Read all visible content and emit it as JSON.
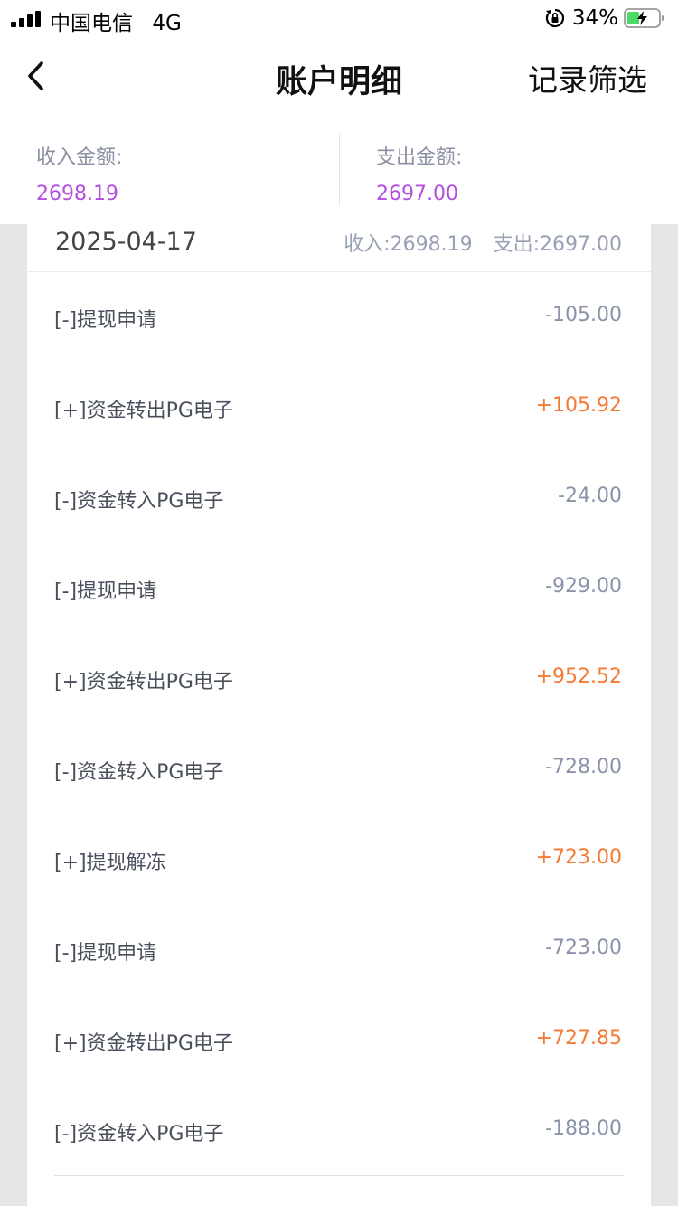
{
  "status_bar": {
    "carrier": "中国电信",
    "network": "4G",
    "battery": "34%"
  },
  "nav": {
    "back_icon": "chevron-left-icon",
    "title": "账户明细",
    "filter_label": "记录筛选"
  },
  "summary": {
    "income_label": "收入金额:",
    "income_value": "2698.19",
    "expense_label": "支出金额:",
    "expense_value": "2697.00"
  },
  "day": {
    "date": "2025-04-17",
    "income_total": "收入:2698.19",
    "expense_total": "支出:2697.00"
  },
  "transactions": [
    {
      "label": "[-]提现申请",
      "amount": "-105.00",
      "type": "neg"
    },
    {
      "label": "[+]资金转出PG电子",
      "amount": "+105.92",
      "type": "pos"
    },
    {
      "label": "[-]资金转入PG电子",
      "amount": "-24.00",
      "type": "neg"
    },
    {
      "label": "[-]提现申请",
      "amount": "-929.00",
      "type": "neg"
    },
    {
      "label": "[+]资金转出PG电子",
      "amount": "+952.52",
      "type": "pos"
    },
    {
      "label": "[-]资金转入PG电子",
      "amount": "-728.00",
      "type": "neg"
    },
    {
      "label": "[+]提现解冻",
      "amount": "+723.00",
      "type": "pos"
    },
    {
      "label": "[-]提现申请",
      "amount": "-723.00",
      "type": "neg"
    },
    {
      "label": "[+]资金转出PG电子",
      "amount": "+727.85",
      "type": "pos"
    },
    {
      "label": "[-]资金转入PG电子",
      "amount": "-188.00",
      "type": "neg"
    }
  ],
  "colors": {
    "positive": "#f57a35",
    "negative": "#8b93aa",
    "summary_value": "#b44ee0"
  }
}
